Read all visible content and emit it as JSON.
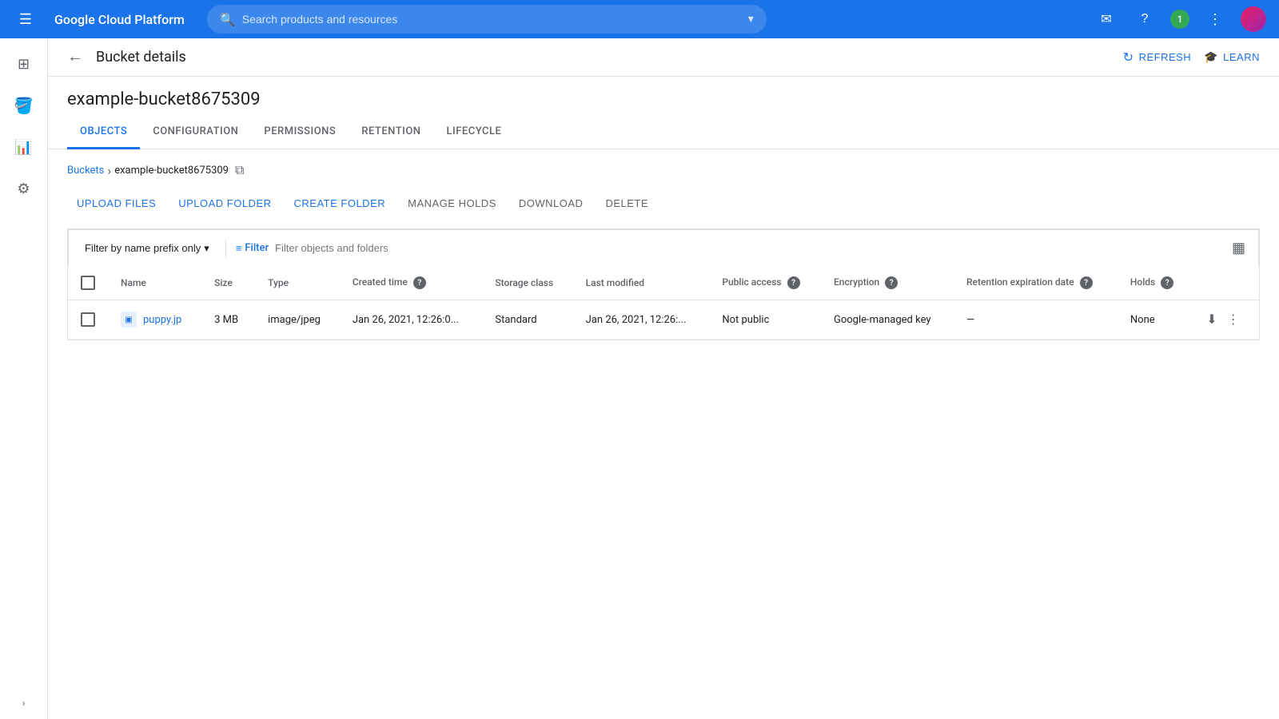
{
  "topnav": {
    "menu_icon": "☰",
    "title": "Google Cloud Platform",
    "search_placeholder": "Search products and resources",
    "expand_icon": "▾",
    "notifications_count": "1",
    "refresh_icon": "↻",
    "learn_icon": "🎓"
  },
  "sidebar": {
    "icons": [
      {
        "name": "grid-icon",
        "symbol": "⊞"
      },
      {
        "name": "storage-icon",
        "symbol": "🪣"
      },
      {
        "name": "analytics-icon",
        "symbol": "📊"
      },
      {
        "name": "settings-icon",
        "symbol": "⚙"
      }
    ],
    "expand_symbol": "›"
  },
  "page_header": {
    "back_icon": "←",
    "title": "Bucket details",
    "refresh_label": "REFRESH",
    "learn_label": "LEARN"
  },
  "bucket": {
    "name": "example-bucket8675309"
  },
  "tabs": [
    {
      "id": "objects",
      "label": "OBJECTS",
      "active": true
    },
    {
      "id": "configuration",
      "label": "CONFIGURATION",
      "active": false
    },
    {
      "id": "permissions",
      "label": "PERMISSIONS",
      "active": false
    },
    {
      "id": "retention",
      "label": "RETENTION",
      "active": false
    },
    {
      "id": "lifecycle",
      "label": "LIFECYCLE",
      "active": false
    }
  ],
  "breadcrumb": {
    "parent_label": "Buckets",
    "separator": "›",
    "current": "example-bucket8675309",
    "copy_icon": "⧉"
  },
  "action_bar": {
    "upload_files": "UPLOAD FILES",
    "upload_folder": "UPLOAD FOLDER",
    "create_folder": "CREATE FOLDER",
    "manage_holds": "MANAGE HOLDS",
    "download": "DOWNLOAD",
    "delete": "DELETE"
  },
  "filter_bar": {
    "prefix_label": "Filter by name prefix only",
    "dropdown_icon": "▾",
    "filter_label": "Filter",
    "filter_icon": "≡",
    "filter_placeholder": "Filter objects and folders",
    "density_icon": "▦"
  },
  "table": {
    "columns": [
      {
        "id": "checkbox",
        "label": ""
      },
      {
        "id": "name",
        "label": "Name"
      },
      {
        "id": "size",
        "label": "Size"
      },
      {
        "id": "type",
        "label": "Type"
      },
      {
        "id": "created_time",
        "label": "Created time",
        "has_help": true
      },
      {
        "id": "storage_class",
        "label": "Storage class"
      },
      {
        "id": "last_modified",
        "label": "Last modified"
      },
      {
        "id": "public_access",
        "label": "Public access",
        "has_help": true
      },
      {
        "id": "encryption",
        "label": "Encryption",
        "has_help": true
      },
      {
        "id": "retention_expiration",
        "label": "Retention expiration date",
        "has_help": true
      },
      {
        "id": "holds",
        "label": "Holds",
        "has_help": true
      },
      {
        "id": "actions",
        "label": ""
      }
    ],
    "rows": [
      {
        "name": "puppy.jp",
        "size": "3 MB",
        "type": "image/jpeg",
        "created_time": "Jan 26, 2021, 12:26:0...",
        "storage_class": "Standard",
        "last_modified": "Jan 26, 2021, 12:26:...",
        "public_access": "Not public",
        "encryption": "Google-managed key",
        "retention_expiration": "—",
        "holds": "None",
        "file_icon": "▣"
      }
    ]
  }
}
